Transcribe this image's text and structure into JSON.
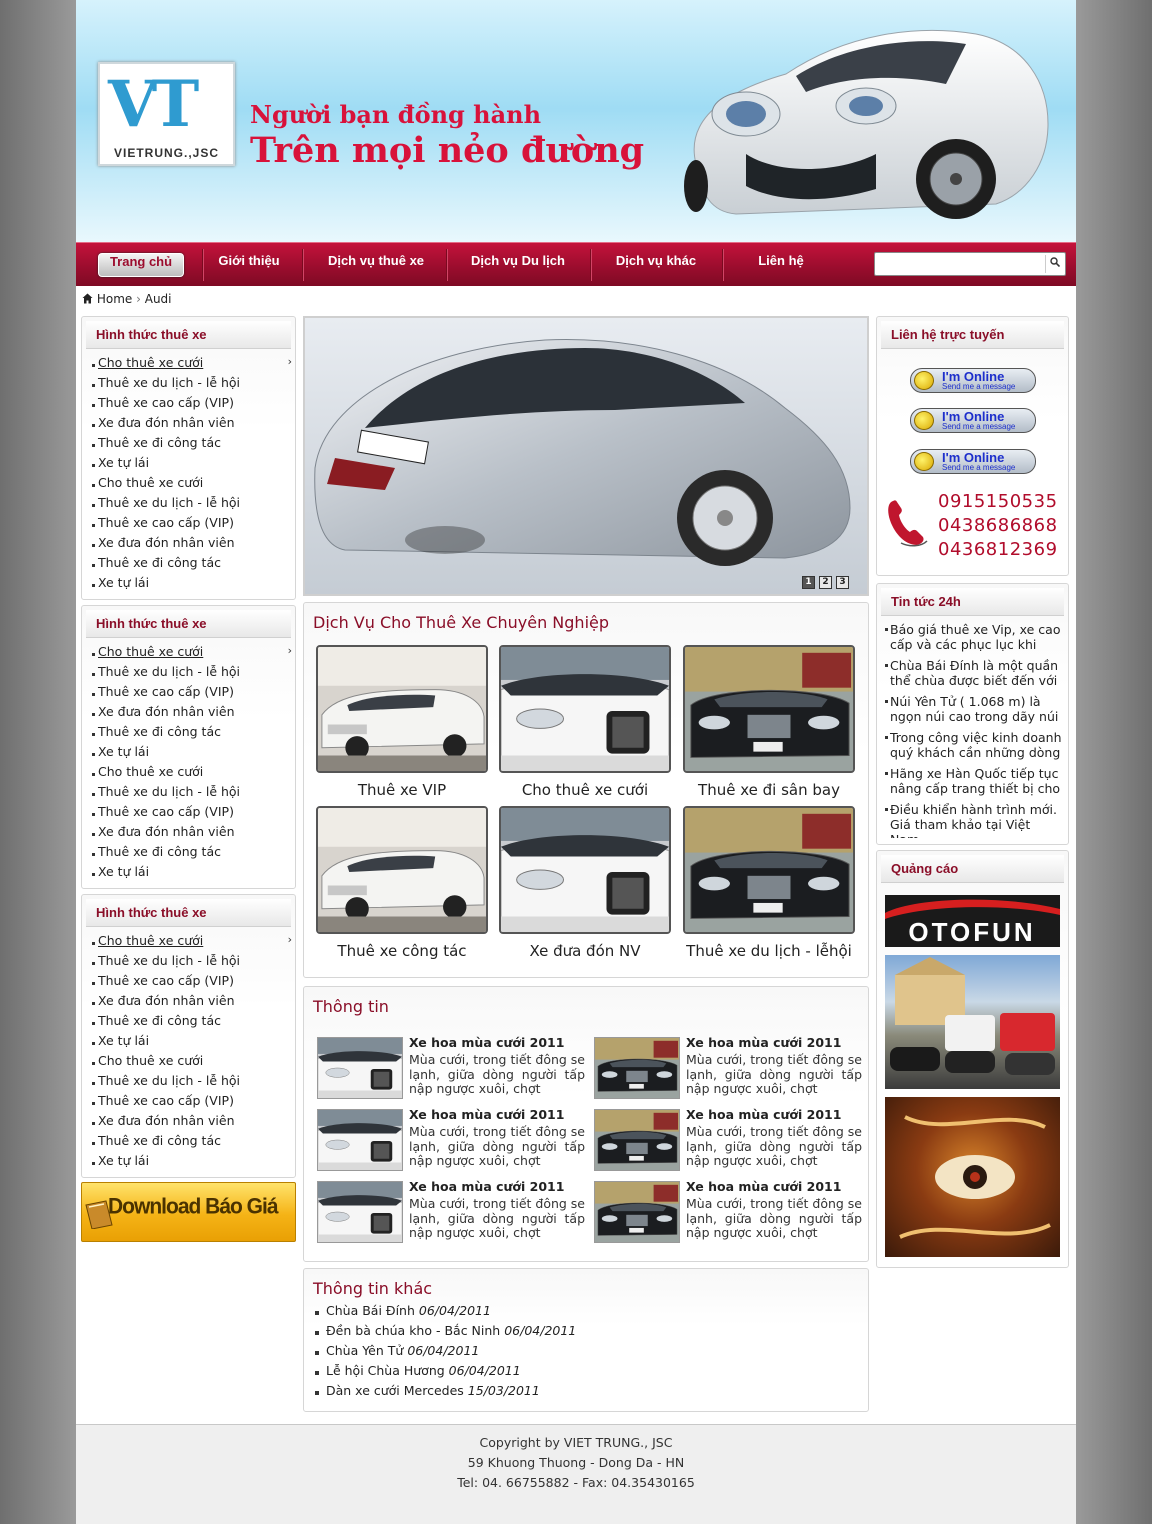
{
  "header": {
    "logo_mark": "VT",
    "logo_text": "VIETRUNG.,JSC",
    "slogan_line1": "Người bạn đồng hành",
    "slogan_line2": "Trên mọi nẻo đường"
  },
  "nav": {
    "items": [
      "Trang chủ",
      "Giới thiệu",
      "Dịch vụ thuê xe",
      "Dịch vụ Du lịch",
      "Dịch vụ khác",
      "Liên hệ"
    ],
    "active": "Trang chủ",
    "search_placeholder": ""
  },
  "breadcrumb": {
    "home": "Home",
    "separator": "›",
    "current": "Audi"
  },
  "left_boxes": [
    {
      "title": "Hình thức thuê xe",
      "items": [
        "Cho thuê xe cưới",
        "Thuê xe du lịch - lễ hội",
        "Thuê xe cao cấp (VIP)",
        "Xe đưa đón nhân viên",
        "Thuê xe đi công tác",
        "Xe tự lái",
        "Cho thuê xe cưới",
        "Thuê xe du lịch - lễ hội",
        "Thuê xe cao cấp (VIP)",
        "Xe đưa đón nhân viên",
        "Thuê xe đi công tác",
        "Xe tự lái"
      ]
    },
    {
      "title": "Hình thức thuê xe",
      "items": [
        "Cho thuê xe cưới",
        "Thuê xe du lịch - lễ hội",
        "Thuê xe cao cấp (VIP)",
        "Xe đưa đón nhân viên",
        "Thuê xe đi công tác",
        "Xe tự lái",
        "Cho thuê xe cưới",
        "Thuê xe du lịch - lễ hội",
        "Thuê xe cao cấp (VIP)",
        "Xe đưa đón nhân viên",
        "Thuê xe đi công tác",
        "Xe tự lái"
      ]
    },
    {
      "title": "Hình thức thuê xe",
      "items": [
        "Cho thuê xe cưới",
        "Thuê xe du lịch - lễ hội",
        "Thuê xe cao cấp (VIP)",
        "Xe đưa đón nhân viên",
        "Thuê xe đi công tác",
        "Xe tự lái",
        "Cho thuê xe cưới",
        "Thuê xe du lịch - lễ hội",
        "Thuê xe cao cấp (VIP)",
        "Xe đưa đón nhân viên",
        "Thuê xe đi công tác",
        "Xe tự lái"
      ]
    }
  ],
  "download_label": "Download Báo Giá",
  "slider": {
    "plate": "B·HD 735",
    "pages": [
      "1",
      "2",
      "3"
    ],
    "current_page": "1"
  },
  "services": {
    "title": "Dịch Vụ Cho Thuê Xe Chuyên Nghiệp",
    "items": [
      {
        "caption": "Thuê xe VIP",
        "car": "white-limo"
      },
      {
        "caption": "Cho thuê xe cưới",
        "car": "white-audi"
      },
      {
        "caption": "Thuê xe đi sân bay",
        "car": "black-lexus"
      },
      {
        "caption": "Thuê xe công tác",
        "car": "white-limo"
      },
      {
        "caption": "Xe đưa đón NV",
        "car": "white-audi"
      },
      {
        "caption": "Thuê xe du lịch - lễhội",
        "car": "black-lexus"
      }
    ]
  },
  "info": {
    "title": "Thông tin",
    "items": [
      {
        "title": "Xe hoa mùa cưới 2011",
        "desc": "Mùa cưới, trong tiết đông se lạnh, giữa dòng người tấp nập ngược xuôi, chợt",
        "car": "white-audi"
      },
      {
        "title": "Xe hoa mùa cưới 2011",
        "desc": "Mùa cưới, trong tiết đông se lạnh, giữa dòng người tấp nập ngược xuôi, chợt",
        "car": "black-lexus"
      },
      {
        "title": "Xe hoa mùa cưới 2011",
        "desc": "Mùa cưới, trong tiết đông se lạnh, giữa dòng người tấp nập ngược xuôi, chợt",
        "car": "white-audi"
      },
      {
        "title": "Xe hoa mùa cưới 2011",
        "desc": "Mùa cưới, trong tiết đông se lạnh, giữa dòng người tấp nập ngược xuôi, chợt",
        "car": "black-lexus"
      },
      {
        "title": "Xe hoa mùa cưới 2011",
        "desc": "Mùa cưới, trong tiết đông se lạnh, giữa dòng người tấp nập ngược xuôi, chợt",
        "car": "white-audi"
      },
      {
        "title": "Xe hoa mùa cưới 2011",
        "desc": "Mùa cưới, trong tiết đông se lạnh, giữa dòng người tấp nập ngược xuôi, chợt",
        "car": "black-lexus"
      }
    ]
  },
  "other_info": {
    "title": "Thông tin khác",
    "items": [
      {
        "text": "Chùa Bái Đính",
        "date": "06/04/2011"
      },
      {
        "text": "Đền bà chúa kho - Bắc Ninh",
        "date": "06/04/2011"
      },
      {
        "text": "Chùa Yên Tử",
        "date": "06/04/2011"
      },
      {
        "text": "Lễ hội Chùa Hương",
        "date": "06/04/2011"
      },
      {
        "text": "Dàn xe cưới Mercedes",
        "date": "15/03/2011"
      }
    ]
  },
  "contact": {
    "title": "Liên hệ trực tuyến",
    "online_line1": "I'm Online",
    "online_line2": "Send me a message",
    "online_count": 3,
    "phones": [
      "0915150535",
      "0438686868",
      "0436812369"
    ]
  },
  "news24": {
    "title": "Tin tức 24h",
    "items": [
      "Báo giá thuê xe Vip, xe cao cấp và các phục lục khi",
      "Chùa Bái Đính là một quần thể chùa được biết đến với",
      "Núi Yên Tử ( 1.068 m) là ngọn núi cao trong dãy núi",
      "Trong công việc kinh doanh quý khách cần những dòng",
      "Hãng xe Hàn Quốc tiếp tục nâng cấp trang thiết bị cho",
      "Điều khiển hành trình mới. Giá tham khảo tại Việt Nam"
    ]
  },
  "ads": {
    "title": "Quảng cáo",
    "otofun_text": "OTOFUN"
  },
  "footer": {
    "line1": "Copyright by VIET TRUNG., JSC",
    "line2": "59 Khuong Thuong -  Dong Da  - HN",
    "line3": "Tel: 04. 66755882 - Fax: 04.35430165"
  },
  "colors": {
    "brand_red": "#9c0d2e",
    "title_red": "#8a0e28",
    "phone_red": "#b10c2b",
    "logo_blue": "#2f9bd0"
  }
}
